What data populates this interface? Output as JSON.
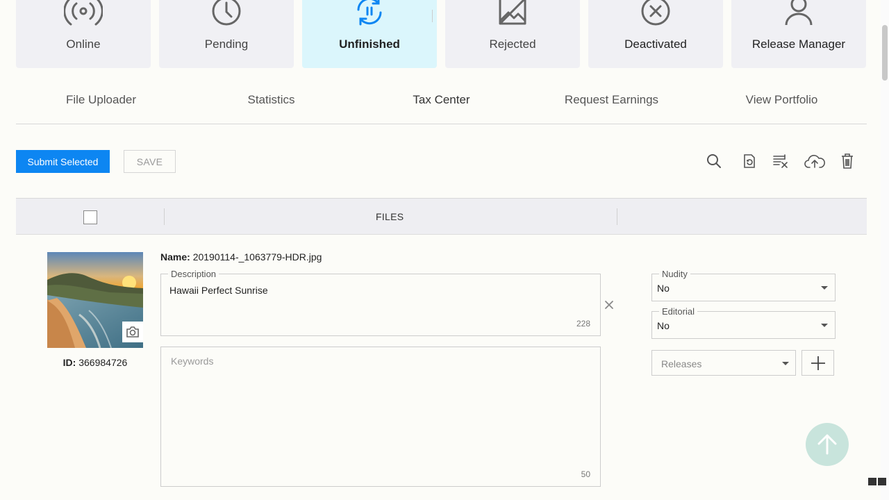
{
  "status_cards": [
    {
      "label": "Online",
      "icon": "broadcast-icon"
    },
    {
      "label": "Pending",
      "icon": "clock-icon"
    },
    {
      "label": "Unfinished",
      "icon": "refresh-pause-icon",
      "active": true
    },
    {
      "label": "Rejected",
      "icon": "no-image-icon"
    },
    {
      "label": "Deactivated",
      "icon": "x-circle-icon"
    },
    {
      "label": "Release Manager",
      "icon": "person-icon"
    }
  ],
  "nav": [
    "File Uploader",
    "Statistics",
    "Tax Center",
    "Request Earnings",
    "View Portfolio"
  ],
  "toolbar": {
    "submit_label": "Submit Selected",
    "save_label": "SAVE",
    "icons": [
      "search-icon",
      "refresh-document-icon",
      "remove-list-icon",
      "cloud-upload-icon",
      "trash-icon"
    ]
  },
  "table": {
    "files_header": "FILES"
  },
  "file": {
    "name_label": "Name:",
    "name": "20190114-_1063779-HDR.jpg",
    "id_label": "ID:",
    "id": "366984726",
    "description_label": "Description",
    "description": "Hawaii Perfect Sunrise",
    "description_counter": "228",
    "keywords_placeholder": "Keywords",
    "keywords_counter": "50",
    "nudity_label": "Nudity",
    "nudity": "No",
    "editorial_label": "Editorial",
    "editorial": "No",
    "releases_placeholder": "Releases"
  },
  "colors": {
    "accent": "#0d86f2",
    "active_card": "#dbf6fc"
  }
}
